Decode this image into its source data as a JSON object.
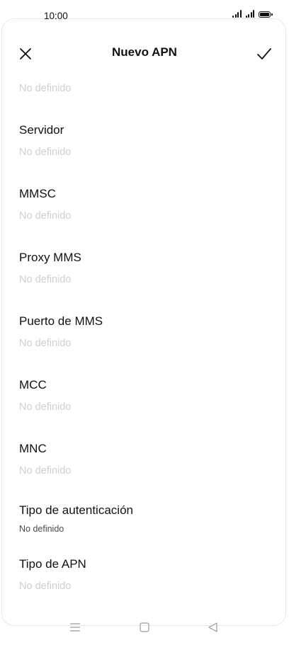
{
  "status": {
    "time": "10:00"
  },
  "header": {
    "title": "Nuevo APN",
    "close_icon": "close-icon",
    "confirm_icon": "check-icon"
  },
  "partial_value": "No definido",
  "fields": [
    {
      "label": "Servidor",
      "value": "No definido"
    },
    {
      "label": "MMSC",
      "value": "No definido"
    },
    {
      "label": "Proxy MMS",
      "value": "No definido"
    },
    {
      "label": "Puerto de MMS",
      "value": "No definido"
    },
    {
      "label": "MCC",
      "value": "No definido"
    },
    {
      "label": "MNC",
      "value": "No definido"
    },
    {
      "label": "Tipo de autenticación",
      "value": "No definido"
    },
    {
      "label": "Tipo de APN",
      "value": "No definido"
    }
  ],
  "nav": {
    "menu_icon": "menu-icon",
    "home_icon": "home-icon",
    "back_icon": "back-icon"
  }
}
